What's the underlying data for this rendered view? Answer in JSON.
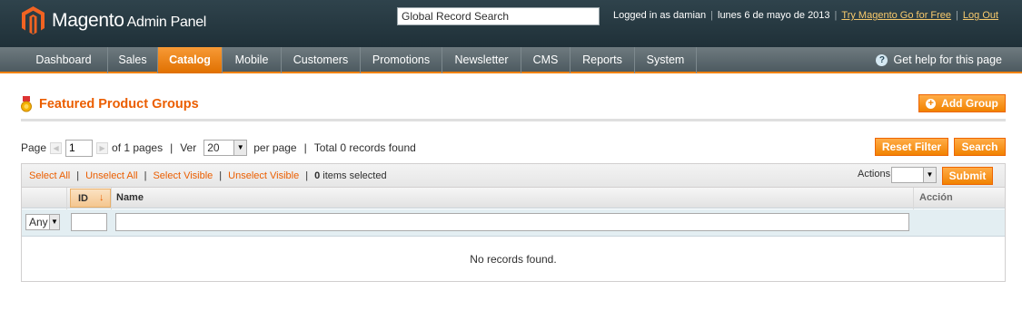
{
  "header": {
    "brand": "Magento",
    "brand_sub": "Admin Panel",
    "search_value": "Global Record Search",
    "logged_in": "Logged in as damian",
    "date": "lunes 6 de mayo de 2013",
    "try_link": "Try Magento Go for Free",
    "logout_link": "Log Out"
  },
  "nav": {
    "items": [
      "Dashboard",
      "Sales",
      "Catalog",
      "Mobile",
      "Customers",
      "Promotions",
      "Newsletter",
      "CMS",
      "Reports",
      "System"
    ],
    "active": "Catalog",
    "help": "Get help for this page"
  },
  "page": {
    "title": "Featured Product Groups",
    "add_button": "Add Group"
  },
  "pager": {
    "page_label": "Page",
    "page_value": "1",
    "of_pages": "of 1 pages",
    "view_label": "Ver",
    "per_page_value": "20",
    "per_page_label": "per page",
    "total": "Total 0 records found",
    "reset_button": "Reset Filter",
    "search_button": "Search"
  },
  "massaction": {
    "select_all": "Select All",
    "unselect_all": "Unselect All",
    "select_visible": "Select Visible",
    "unselect_visible": "Unselect Visible",
    "selected_count": "0",
    "selected_label": "items selected",
    "actions_label": "Actions",
    "submit_button": "Submit"
  },
  "grid": {
    "columns": [
      "ID",
      "Name",
      "Acción"
    ],
    "filter_any": "Any",
    "empty_message": "No records found."
  },
  "colors": {
    "accent": "#eb5e00",
    "header_bg": "#2a3c44",
    "nav_bg": "#5f6b70",
    "button": "#f18200"
  }
}
